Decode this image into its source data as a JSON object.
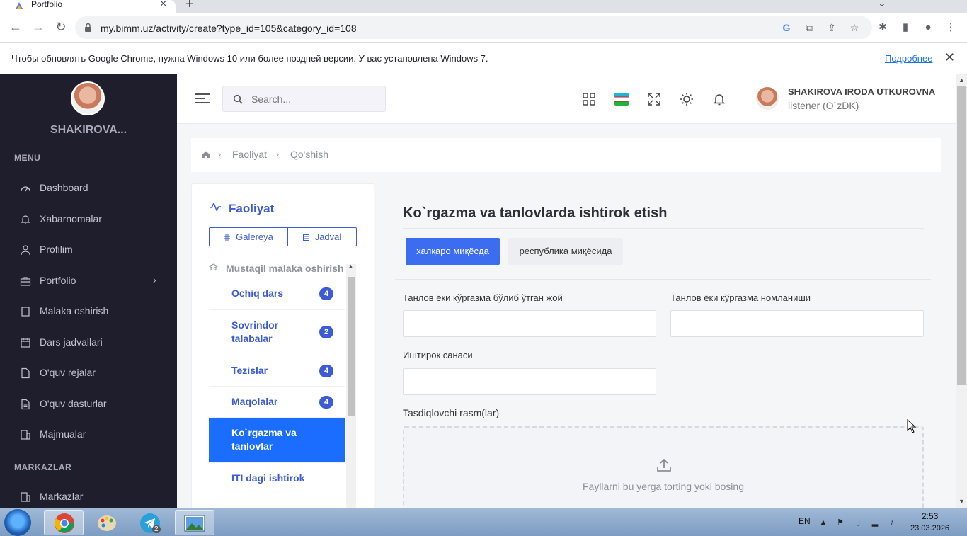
{
  "browser": {
    "tab_title": "Portfolio",
    "url": "my.bimm.uz/activity/create?type_id=105&category_id=108",
    "info_text": "Чтобы обновлять Google Chrome, нужна Windows 10 или более поздней версии. У вас установлена Windows 7.",
    "info_link": "Подробнее"
  },
  "sidebar": {
    "user_short": "SHAKIROVA...",
    "menu_header": "MENU",
    "items": [
      {
        "label": "Dashboard",
        "icon": "dashboard-icon"
      },
      {
        "label": "Xabarnomalar",
        "icon": "bell-icon"
      },
      {
        "label": "Profilim",
        "icon": "user-icon"
      },
      {
        "label": "Portfolio",
        "icon": "briefcase-icon",
        "arrow": "›"
      },
      {
        "label": "Malaka oshirish",
        "icon": "book-icon"
      },
      {
        "label": "Dars jadvallari",
        "icon": "calendar-icon"
      },
      {
        "label": "O'quv rejalar",
        "icon": "file-icon"
      },
      {
        "label": "O'quv dasturlar",
        "icon": "file-list-icon"
      },
      {
        "label": "Majmualar",
        "icon": "building-icon"
      }
    ],
    "centers_header": "MARKAZLAR",
    "centers_items": [
      {
        "label": "Markazlar",
        "icon": "building-icon"
      }
    ]
  },
  "topbar": {
    "search_placeholder": "Search...",
    "user_name": "SHAKIROVA IRODA UTKUROVNA",
    "user_role": "listener (O`zDK)"
  },
  "breadcrumb": {
    "items": [
      "Faoliyat",
      "Qo'shish"
    ]
  },
  "left_panel": {
    "title": "Faoliyat",
    "view_gallery": "Galereya",
    "view_table": "Jadval",
    "group_label": "Mustaqil malaka oshirish",
    "items": [
      {
        "label": "Ochiq dars",
        "badge": "4"
      },
      {
        "label": "Sovrindor talabalar",
        "badge": "2"
      },
      {
        "label": "Tezislar",
        "badge": "4"
      },
      {
        "label": "Maqolalar",
        "badge": "4"
      },
      {
        "label": "Ko`rgazma va tanlovlar",
        "badge": ""
      },
      {
        "label": "ITI dagi ishtirok",
        "badge": ""
      }
    ]
  },
  "form": {
    "title": "Ko`rgazma va tanlovlarda ishtirok etish",
    "pill_active": "халқаро миқёсда",
    "pill_inactive": "республика миқёсида",
    "field1_label": "Танлов ёки кўргазма бўлиб ўтган жой",
    "field2_label": "Танлов ёки кўргазма номланиши",
    "field3_label": "Иштирок санаси",
    "field1_value": "",
    "field2_value": "",
    "field3_value": "",
    "upload_label": "Tasdiqlovchi rasm(lar)",
    "upload_text": "Fayllarni bu yerga torting yoki bosing"
  },
  "taskbar": {
    "lang": "EN",
    "time": "2:53",
    "date": "23.03.2026",
    "telegram_badge": "2"
  },
  "colors": {
    "sidebar_bg": "#1e1e2d",
    "accent": "#3c5bd6",
    "active_item": "#1a6dff",
    "primary_button": "#3c6cf0"
  }
}
